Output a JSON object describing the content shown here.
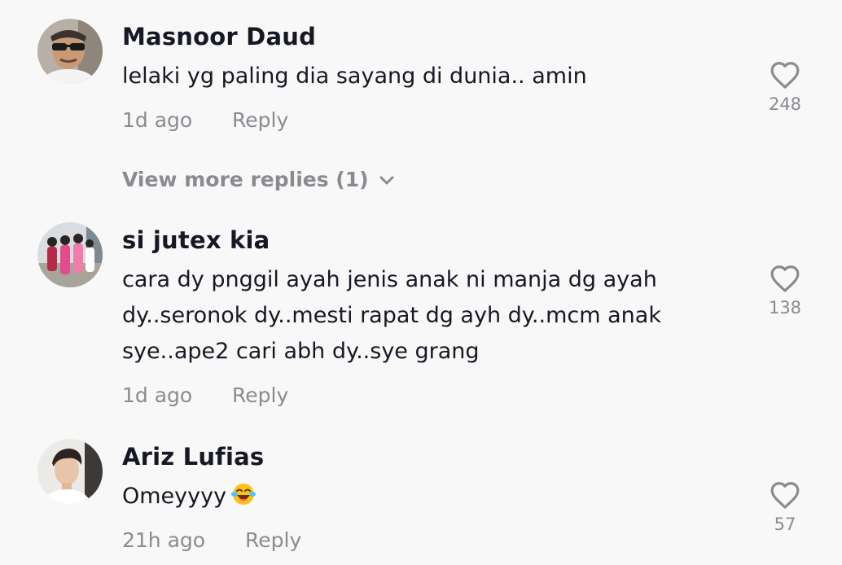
{
  "comments": [
    {
      "username": "Masnoor Daud",
      "text_lines": [
        "lelaki yg paling dia sayang di dunia.. amin"
      ],
      "time": "1d ago",
      "reply_label": "Reply",
      "like_count": "248",
      "avatar": "man-sunglasses-avatar",
      "view_more": "View more replies (1)"
    },
    {
      "username": "si jutex kia",
      "text_lines": [
        "cara dy pnggil ayah jenis anak ni manja dg ayah",
        "dy..seronok dy..mesti rapat dg ayh dy..mcm anak",
        "sye..ape2 cari abh dy..sye grang"
      ],
      "time": "1d ago",
      "reply_label": "Reply",
      "like_count": "138",
      "avatar": "group-photo-avatar"
    },
    {
      "username": "Ariz Lufias",
      "text": "Omeyyyy",
      "emoji": "face-with-tears-of-joy",
      "time": "21h ago",
      "reply_label": "Reply",
      "like_count": "57",
      "avatar": "young-man-avatar"
    }
  ],
  "icons": {
    "like": "heart-outline-icon",
    "expand": "chevron-down-icon"
  },
  "colors": {
    "background": "#f8f8f8",
    "primary_text": "#161823",
    "secondary_text": "#8a8b91",
    "icon": "#8a8b91"
  }
}
